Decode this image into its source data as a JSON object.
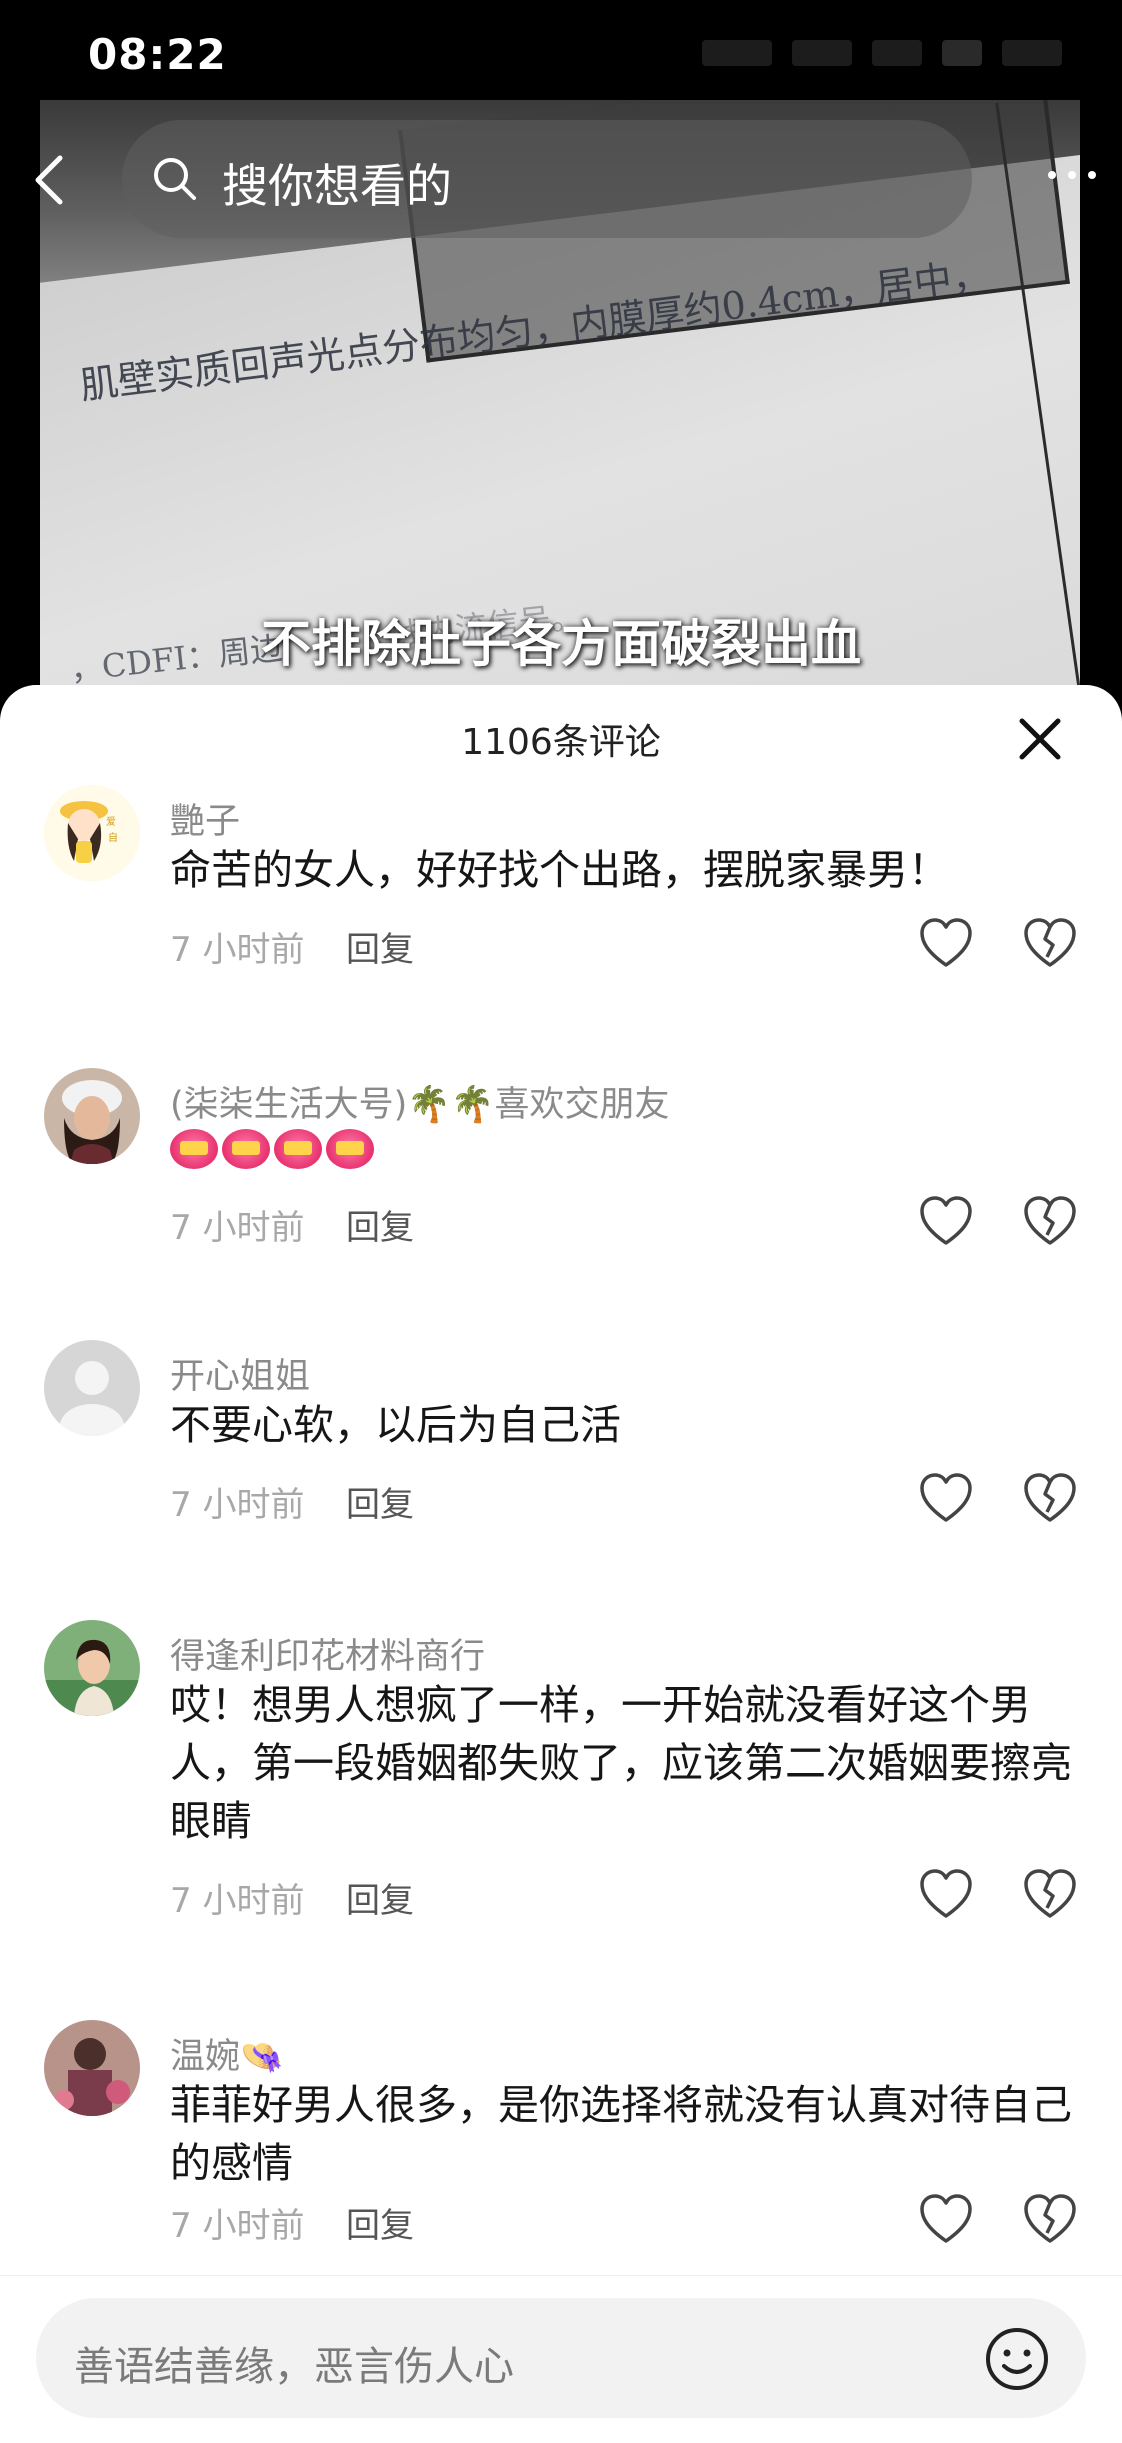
{
  "status_bar": {
    "time": "08:22"
  },
  "video": {
    "document_line_1": "肌壁实质回声光点分布均匀，内膜厚约0.4cm，居中，",
    "document_line_2": "，CDFI：周边",
    "document_line_2b": "线内流信号。",
    "subtitle": "不排除肚子各方面破裂出血"
  },
  "search": {
    "placeholder": "搜你想看的"
  },
  "comments_panel": {
    "title": "1106条评论",
    "comments": [
      {
        "name": "艷子",
        "text": "命苦的女人，好好找个出路，摆脱家暴男！",
        "time": "7 小时前",
        "reply": "回复"
      },
      {
        "name": "(柒柒生活大号)🌴🌴喜欢交朋友",
        "text": "",
        "time": "7 小时前",
        "reply": "回复",
        "emoji_count": 4,
        "emoji_name": "jiayou-heart-emoji"
      },
      {
        "name": "开心姐姐",
        "text": "不要心软，以后为自己活",
        "time": "7 小时前",
        "reply": "回复"
      },
      {
        "name": "得逢利印花材料商行",
        "text": "哎！想男人想疯了一样，一开始就没看好这个男人，第一段婚姻都失败了，应该第二次婚姻要擦亮眼睛",
        "time": "7 小时前",
        "reply": "回复"
      },
      {
        "name": "温婉👒",
        "text": "菲菲好男人很多，是你选择将就没有认真对待自己的感情",
        "time": "7 小时前",
        "reply": "回复"
      }
    ]
  },
  "input": {
    "placeholder": "善语结善缘，恶言伤人心"
  },
  "icons": {
    "back": "chevron-left-icon",
    "search": "search-icon",
    "more": "more-dots-icon",
    "close": "close-icon",
    "like": "heart-outline-icon",
    "dislike": "broken-heart-icon",
    "emoji": "smiley-icon"
  },
  "colors": {
    "sheet_bg": "#ffffff",
    "name_gray": "#8a8a8a",
    "text_dark": "#161616",
    "time_gray": "#a8a8a8"
  }
}
